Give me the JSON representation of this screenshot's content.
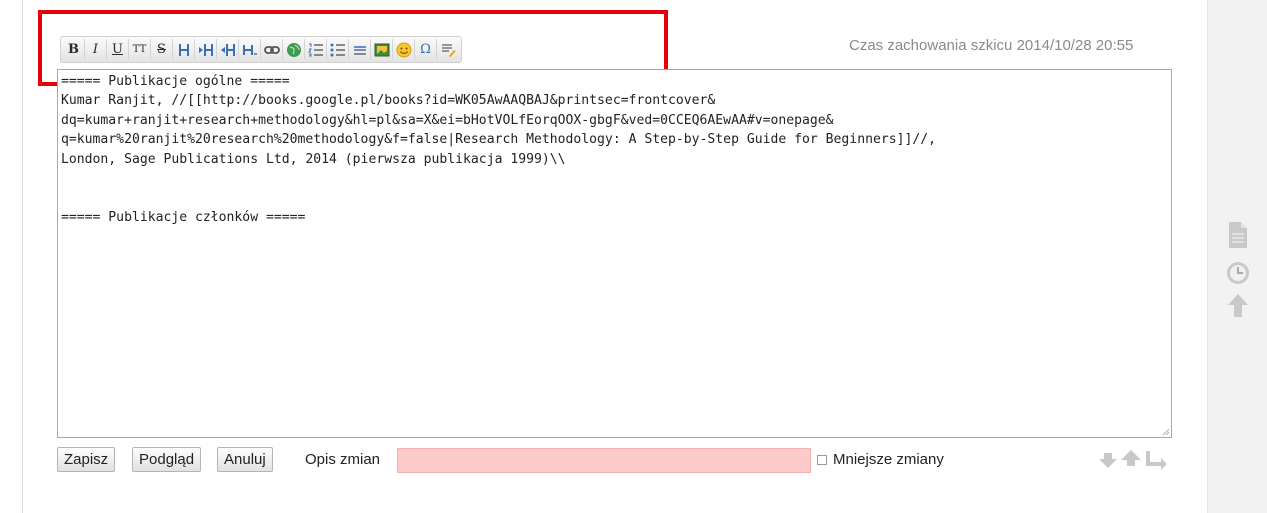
{
  "toolbar": {
    "buttons": [
      {
        "name": "bold-button",
        "glyph": "B"
      },
      {
        "name": "italic-button",
        "glyph": "I"
      },
      {
        "name": "underline-button",
        "glyph": "U"
      },
      {
        "name": "monospace-button",
        "glyph": "TT"
      },
      {
        "name": "strikethrough-button",
        "glyph": "S"
      },
      {
        "name": "heading-same-level-button",
        "glyph": ""
      },
      {
        "name": "heading-lower-level-button",
        "glyph": ""
      },
      {
        "name": "heading-higher-level-button",
        "glyph": ""
      },
      {
        "name": "heading-select-button",
        "glyph": ""
      },
      {
        "name": "link-button",
        "glyph": ""
      },
      {
        "name": "external-link-button",
        "glyph": ""
      },
      {
        "name": "ordered-list-button",
        "glyph": ""
      },
      {
        "name": "unordered-list-button",
        "glyph": ""
      },
      {
        "name": "horizontal-rule-button",
        "glyph": ""
      },
      {
        "name": "media-button",
        "glyph": ""
      },
      {
        "name": "smiley-button",
        "glyph": ""
      },
      {
        "name": "special-chars-button",
        "glyph": "Ω"
      },
      {
        "name": "signature-button",
        "glyph": ""
      }
    ]
  },
  "draft_time": "Czas zachowania szkicu 2014/10/28 20:55",
  "editor": {
    "content": "===== Publikacje ogólne =====\nKumar Ranjit, //[[http://books.google.pl/books?id=WK05AwAAQBAJ&printsec=frontcover&\ndq=kumar+ranjit+research+methodology&hl=pl&sa=X&ei=bHotVOLfEorqOOX-gbgF&ved=0CCEQ6AEwAA#v=onepage&\nq=kumar%20ranjit%20research%20methodology&f=false|Research Methodology: A Step-by-Step Guide for Beginners]]//,\nLondon, Sage Publications Ltd, 2014 (pierwsza publikacja 1999)\\\\\n\n\n===== Publikacje członków ====="
  },
  "buttons": {
    "save": "Zapisz",
    "preview": "Podgląd",
    "cancel": "Anuluj"
  },
  "summary": {
    "label": "Opis zmian",
    "value": ""
  },
  "minor": {
    "label": "Mniejsze zmiany",
    "checked": false
  },
  "colors": {
    "highlight": "#e8000b",
    "summary_bg": "#fdcaca"
  }
}
